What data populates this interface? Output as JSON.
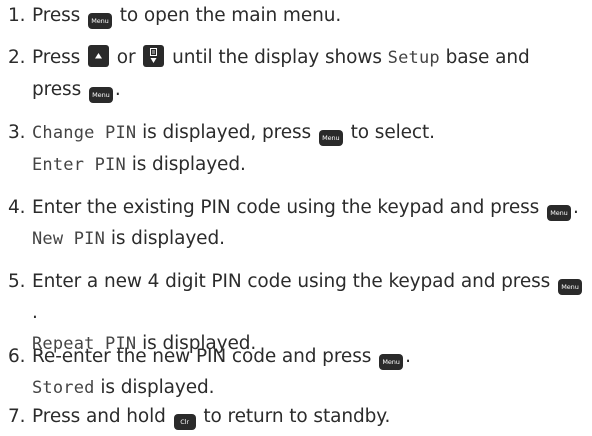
{
  "keys": {
    "menu": "Menu",
    "clear": "Clr"
  },
  "steps": [
    {
      "number": "1.",
      "t1": "Press",
      "t2": "to open the main menu."
    },
    {
      "number": "2.",
      "t1": "Press",
      "t2": "or",
      "t3": "until the display shows",
      "lcd1": "Setup",
      "t4": "base and",
      "t5": "press",
      "t6": "."
    },
    {
      "number": "3.",
      "lcd1": "Change PIN",
      "t1": "is displayed, press",
      "t2": "to select.",
      "lcd2": "Enter PIN",
      "t3": "is displayed."
    },
    {
      "number": "4.",
      "t1": "Enter the existing PIN code using the keypad and press",
      "t2": ".",
      "lcd1": "New PIN",
      "t3": "is displayed."
    },
    {
      "number": "5.",
      "t1": "Enter a new 4 digit PIN code using the keypad and press",
      "t2": ".",
      "lcd1": "Repeat PIN",
      "t3": "is displayed."
    },
    {
      "number": "6.",
      "t1": "Re-enter the new PIN code and press",
      "t2": ".",
      "lcd1": "Stored",
      "t3": "is displayed."
    },
    {
      "number": "7.",
      "t1": "Press and hold",
      "t2": "to return to standby."
    }
  ]
}
